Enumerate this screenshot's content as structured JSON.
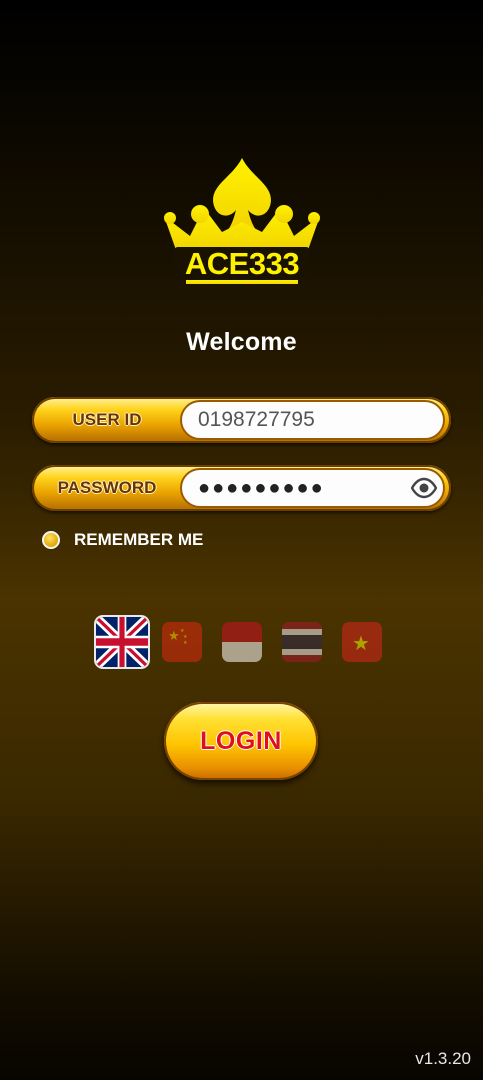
{
  "brand": {
    "logo_text": "ACE333"
  },
  "welcome": "Welcome",
  "form": {
    "user_id": {
      "label": "USER ID",
      "value": "0198727795"
    },
    "password": {
      "label": "PASSWORD",
      "masked_value": "●●●●●●●●●",
      "toggle_icon": "eye-icon"
    },
    "remember": {
      "label": "REMEMBER ME",
      "checked": true
    }
  },
  "languages": [
    {
      "name": "english-flag",
      "selected": true
    },
    {
      "name": "china-flag",
      "selected": false
    },
    {
      "name": "indonesia-flag",
      "selected": false
    },
    {
      "name": "thailand-flag",
      "selected": false
    },
    {
      "name": "vietnam-flag",
      "selected": false
    }
  ],
  "login_button": "LOGIN",
  "version": "v1.3.20",
  "colors": {
    "gold": "#ffd21a",
    "login_text": "#e0101a",
    "label_text": "#6b3300"
  }
}
